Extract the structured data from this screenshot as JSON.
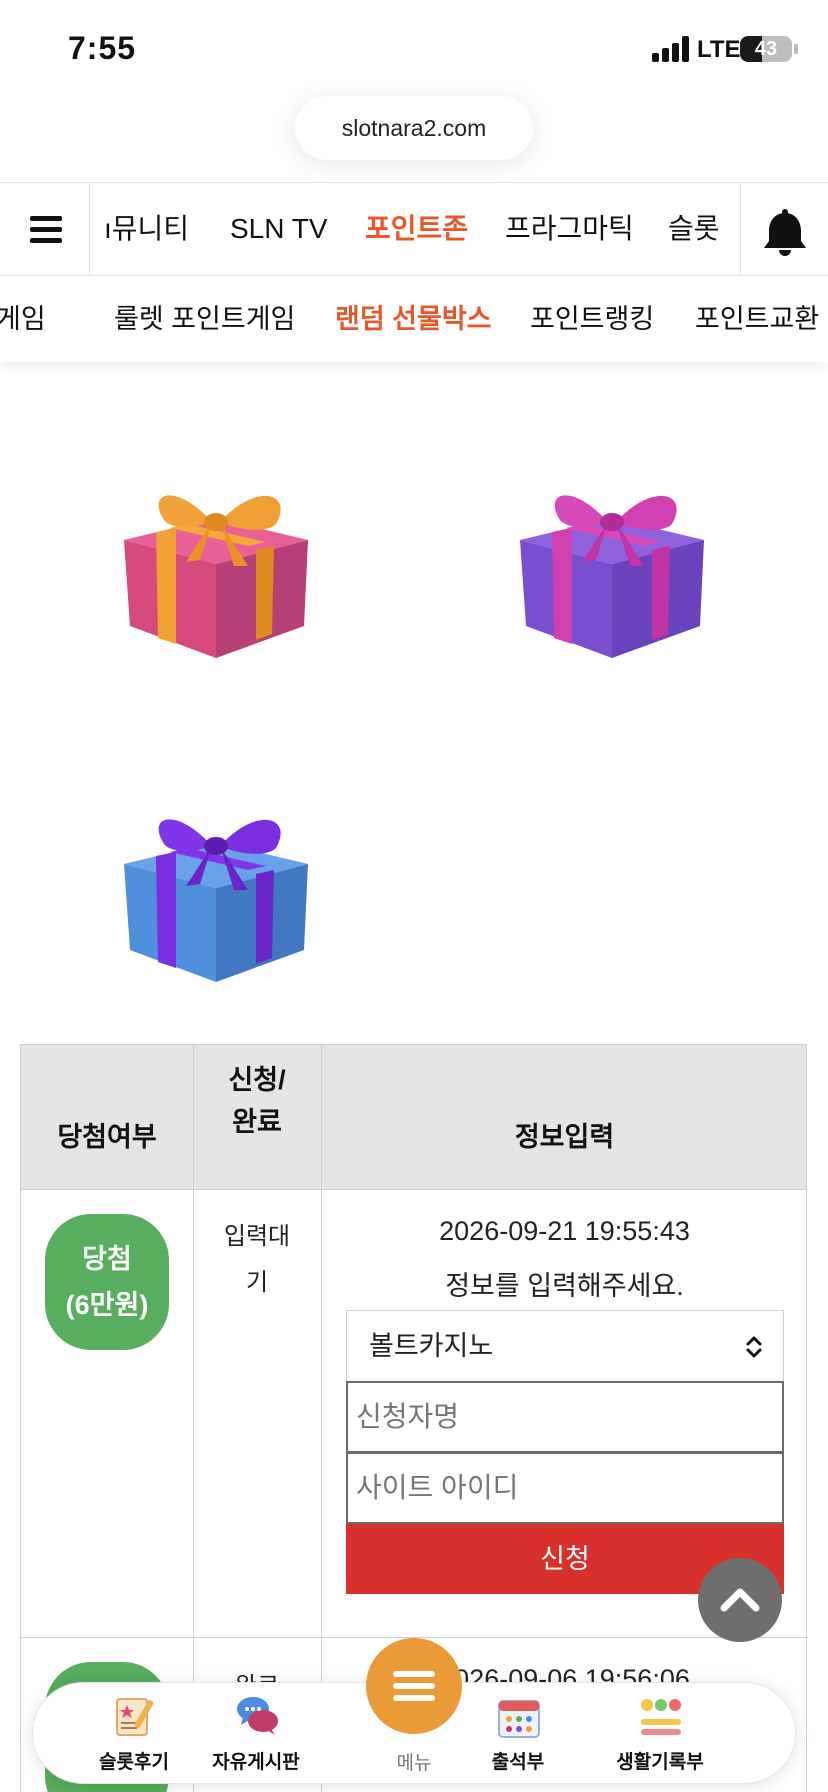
{
  "status_bar": {
    "time": "7:55",
    "network": "LTE",
    "battery": "43",
    "battery_level": 0.43
  },
  "browser": {
    "url": "slotnara2.com"
  },
  "nav": {
    "items": [
      "ı뮤니티",
      "SLN TV",
      "포인트존",
      "프라그마틱",
      "슬롯"
    ],
    "active_index": 2
  },
  "subnav": {
    "items": [
      "게임",
      "룰렛 포인트게임",
      "랜덤 선물박스",
      "포인트랭킹",
      "포인트교환"
    ],
    "active_index": 2
  },
  "gifts": [
    {
      "name": "gift-box-pink",
      "box": "#d7487c",
      "ribbon": "#f0a034"
    },
    {
      "name": "gift-box-purple",
      "box": "#7a4fcf",
      "ribbon": "#d23fb0"
    },
    {
      "name": "gift-box-blue",
      "box": "#4f8fdb",
      "ribbon": "#7a2ee0"
    }
  ],
  "table": {
    "headers": {
      "result": "당첨여부",
      "status_line1": "신청/",
      "status_line2": "완료",
      "info": "정보입력"
    },
    "rows": [
      {
        "result_line1": "당첨",
        "result_line2": "(6만원)",
        "status_line1": "입력대",
        "status_line2": "기",
        "datetime": "2026-09-21 19:55:43",
        "message": "정보를 입력해주세요.",
        "site_select": "볼트카지노",
        "name_placeholder": "신청자명",
        "id_placeholder": "사이트 아이디",
        "submit_label": "신청"
      },
      {
        "status_partial": "완료",
        "datetime_partial": "2026-09-06 19:56:06"
      }
    ]
  },
  "bottom_bar": {
    "items": [
      {
        "label": "슬롯후기",
        "icon": "review-icon"
      },
      {
        "label": "자유게시판",
        "icon": "chat-icon"
      },
      {
        "label": "메뉴",
        "icon": "menu-icon"
      },
      {
        "label": "출석부",
        "icon": "calendar-icon"
      },
      {
        "label": "생활기록부",
        "icon": "emoji-record-icon"
      }
    ]
  },
  "colors": {
    "accent": "#e8572a",
    "win_badge": "#58ad5e",
    "submit": "#d8302c",
    "menu_fab": "#ea9b37"
  }
}
